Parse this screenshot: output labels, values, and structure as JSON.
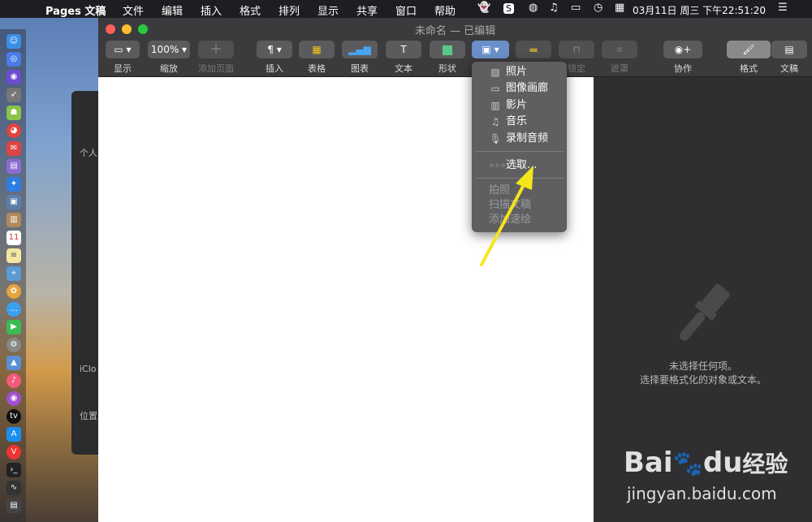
{
  "menubar": {
    "app": "Pages 文稿",
    "items": [
      "文件",
      "编辑",
      "插入",
      "格式",
      "排列",
      "显示",
      "共享",
      "窗口",
      "帮助"
    ],
    "clock": "03月11日 周三 下午22:51:20"
  },
  "window": {
    "title": "未命名 — 已编辑",
    "toolbar": {
      "view": "显示",
      "zoom_value": "100%",
      "zoom": "缩放",
      "add_page": "添加页面",
      "insert": "插入",
      "table": "表格",
      "chart": "图表",
      "text": "文本",
      "shape": "形状",
      "lock": "锁定",
      "mask": "遮罩",
      "collab": "协作",
      "format": "格式",
      "document": "文稿"
    }
  },
  "media_menu": {
    "items": [
      {
        "label": "照片",
        "icon": "photo-icon"
      },
      {
        "label": "图像画廊",
        "icon": "gallery-icon"
      },
      {
        "label": "影片",
        "icon": "film-icon"
      },
      {
        "label": "音乐",
        "icon": "music-icon"
      },
      {
        "label": "录制音频",
        "icon": "microphone-icon"
      }
    ],
    "choose": "选取...",
    "disabled": [
      "拍照",
      "扫描文稿",
      "添加速绘"
    ]
  },
  "inspector": {
    "line1": "未选择任何项。",
    "line2": "选择要格式化的对象或文本。"
  },
  "finder": {
    "personal": "个人",
    "icloud": "iClo",
    "location": "位置"
  },
  "watermark": {
    "brand": "Bai",
    "brand2": "du",
    "cn": "经验",
    "url": "jingyan.baidu.com"
  },
  "colors": {
    "annotation_arrow": "#f5e61c",
    "traffic_red": "#fe5f57",
    "traffic_yellow": "#febc2e",
    "traffic_green": "#28c840"
  }
}
